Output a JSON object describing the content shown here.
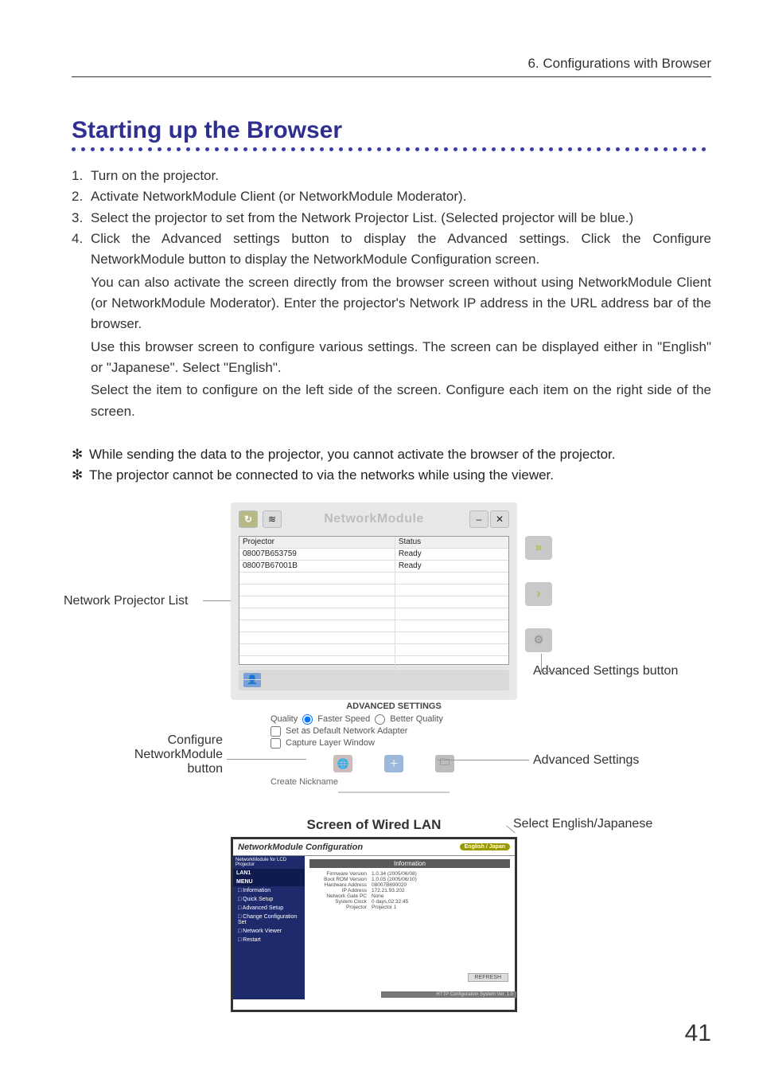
{
  "chapter": "6. Configurations with Browser",
  "title": "Starting up the Browser",
  "steps": [
    {
      "n": "1.",
      "t": "Turn on the projector."
    },
    {
      "n": "2.",
      "t": "Activate NetworkModule Client (or NetworkModule Moderator)."
    },
    {
      "n": "3.",
      "t": "Select the projector to set from the Network Projector List. (Selected projector will be blue.)"
    },
    {
      "n": "4.",
      "t": "Click the Advanced settings button to display the Advanced settings. Click the Configure NetworkModule button to display the NetworkModule Configuration screen."
    }
  ],
  "indented": [
    "You can also activate the screen directly from the browser screen without using NetworkModule Client (or NetworkModule Moderator). Enter the projector's Network IP address in the URL address bar of the browser.",
    "Use this browser screen to configure various settings. The screen can be displayed either in \"English\" or \"Japanese\". Select \"English\".",
    "Select the item to configure on the left side of the screen. Configure each item on the right side of the screen."
  ],
  "notes": [
    "While sending the data to the projector, you cannot activate the browser of the projector.",
    "The projector cannot be connected to via the networks while using the viewer."
  ],
  "labels": {
    "projector_list": "Network Projector List",
    "adv_btn": "Advanced Settings button",
    "conf_btn": "Configure NetworkModule button",
    "adv_settings": "Advanced Settings",
    "wired_title": "Screen of Wired LAN",
    "lang_select": "Select English/Japanese"
  },
  "app": {
    "title": "NetworkModule",
    "col_projector": "Projector",
    "col_status": "Status",
    "rows": [
      {
        "p": "08007B653759",
        "s": "Ready"
      },
      {
        "p": "08007B67001B",
        "s": "Ready"
      }
    ],
    "adv_heading": "ADVANCED SETTINGS",
    "quality": "Quality",
    "faster": "Faster Speed",
    "better": "Better Quality",
    "set_default": "Set as Default Network Adapter",
    "capture": "Capture Layer Window",
    "nickname": "Create Nickname"
  },
  "config": {
    "header": "NetworkModule Configuration",
    "lang": "English / Japan",
    "side_top": "NetworkModule for LCD Projector",
    "groups": [
      "LAN1",
      "MENU"
    ],
    "items": [
      "Information",
      "Quick Setup",
      "Advanced Setup",
      "Change Configuration Set",
      "Network Viewer",
      "Restart"
    ],
    "info_title": "Information",
    "kv": [
      {
        "k": "Firmware Version",
        "v": "1.0.34 (2005/06/08)"
      },
      {
        "k": "Boot ROM Version",
        "v": "1.0.05 (2005/06/10)"
      },
      {
        "k": "Hardware Address",
        "v": "08007B690020"
      },
      {
        "k": "IP Address",
        "v": "172.21.93.202"
      },
      {
        "k": "Network Gate PC",
        "v": "None"
      },
      {
        "k": "System Clock",
        "v": "0 days,02:32:45"
      },
      {
        "k": "Projector",
        "v": "Projector 1"
      }
    ],
    "refresh": "REFRESH",
    "footer": "HTTP Configuration System Ver. 1.0"
  },
  "page_no": "41",
  "star": "✻"
}
